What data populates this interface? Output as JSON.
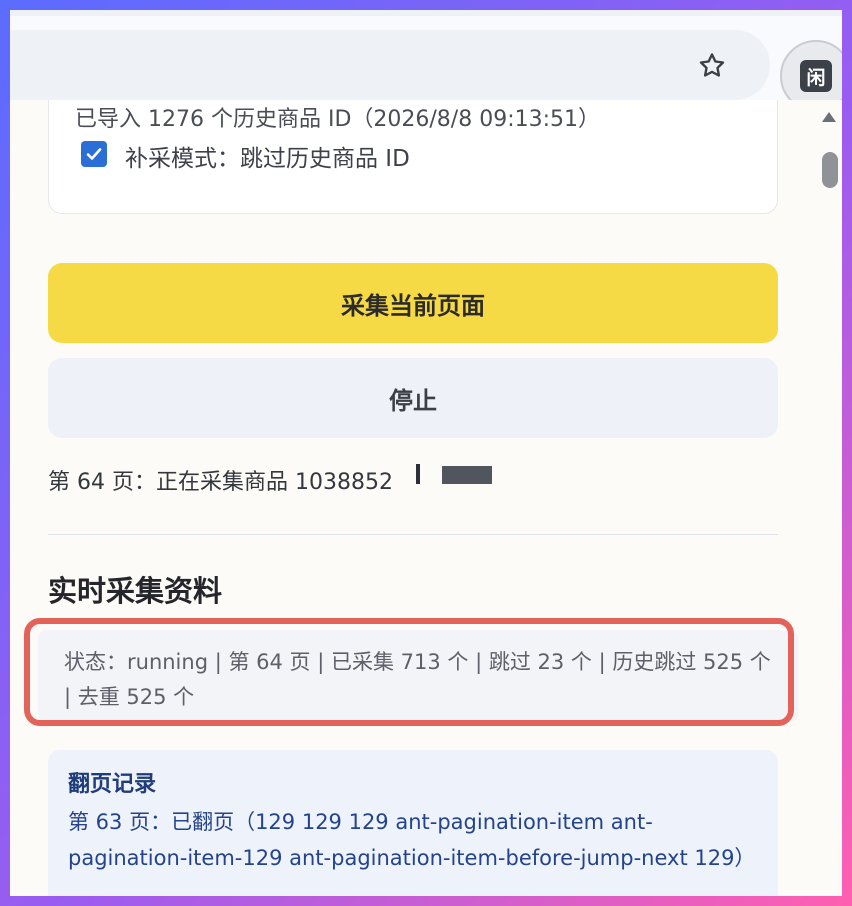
{
  "browser": {
    "extension_badge": "闲"
  },
  "panel": {
    "import_status": "已导入 1276 个历史商品 ID（2026/8/8 09:13:51）",
    "supplement_mode_label": "补采模式：跳过历史商品 ID",
    "supplement_mode_checked": true,
    "collect_button_label": "采集当前页面",
    "stop_button_label": "停止",
    "progress_text": "第 64 页：正在采集商品 1038852",
    "section_title": "实时采集资料",
    "status_text": "状态：running | 第 64 页 | 已采集 713 个 | 跳过 23 个 | 历史跳过 525 个 | 去重 525 个",
    "page_log": {
      "title": "翻页记录",
      "entry": "第 63 页：已翻页（129 129 129 ant-pagination-item ant-pagination-item-129 ant-pagination-item-before-jump-next 129）"
    }
  },
  "colors": {
    "collect_button": "#f6da45",
    "highlight_border": "#e3635b",
    "checkbox": "#2b6fd6",
    "log_text": "#24438a"
  }
}
